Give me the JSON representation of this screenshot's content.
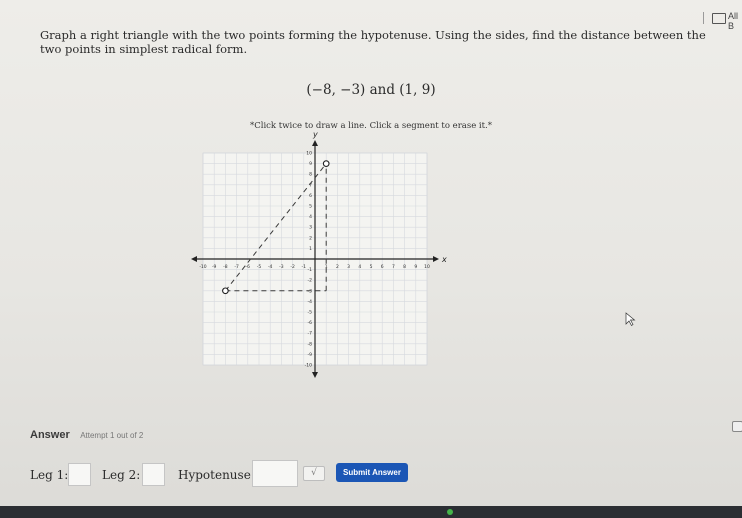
{
  "topbar": {
    "all_label": "All B"
  },
  "question": {
    "text": "Graph a right triangle with the two points forming the hypotenuse. Using the sides, find the distance between the two points in simplest radical form.",
    "points": "(−8, −3) and (1, 9)",
    "instruction": "*Click twice to draw a line. Click a segment to erase it.*"
  },
  "graph": {
    "x_axis_label": "x",
    "y_axis_label": "y",
    "x_range": [
      -10,
      10
    ],
    "y_range": [
      -10,
      10
    ],
    "grid": true,
    "points": [
      {
        "x": -8,
        "y": -3
      },
      {
        "x": 1,
        "y": 9
      }
    ],
    "dashed_segments": [
      {
        "from": [
          -8,
          -3
        ],
        "to": [
          1,
          9
        ]
      },
      {
        "from": [
          -8,
          -3
        ],
        "to": [
          1,
          -3
        ]
      },
      {
        "from": [
          1,
          -3
        ],
        "to": [
          1,
          9
        ]
      }
    ]
  },
  "answer": {
    "title": "Answer",
    "attempt": "Attempt 1 out of 2",
    "leg1_label": "Leg 1:",
    "leg2_label": "Leg 2:",
    "hyp_label": "Hypotenuse:",
    "sqrt_symbol": "√",
    "submit_label": "Submit Answer"
  }
}
